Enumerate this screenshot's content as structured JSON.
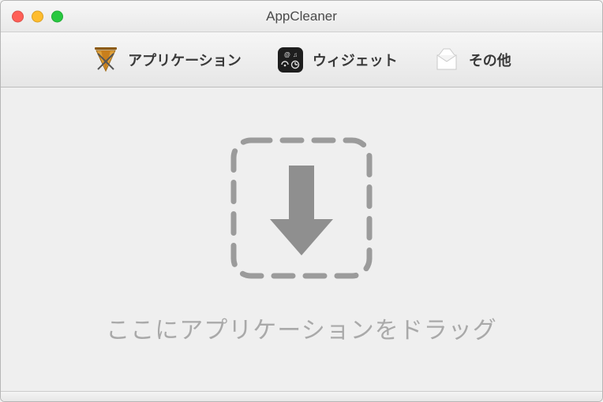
{
  "window": {
    "title": "AppCleaner"
  },
  "toolbar": {
    "items": [
      {
        "icon": "applications-icon",
        "label": "アプリケーション"
      },
      {
        "icon": "widgets-icon",
        "label": "ウィジェット"
      },
      {
        "icon": "others-icon",
        "label": "その他"
      }
    ]
  },
  "drop": {
    "hint": "ここにアプリケーションをドラッグ"
  }
}
